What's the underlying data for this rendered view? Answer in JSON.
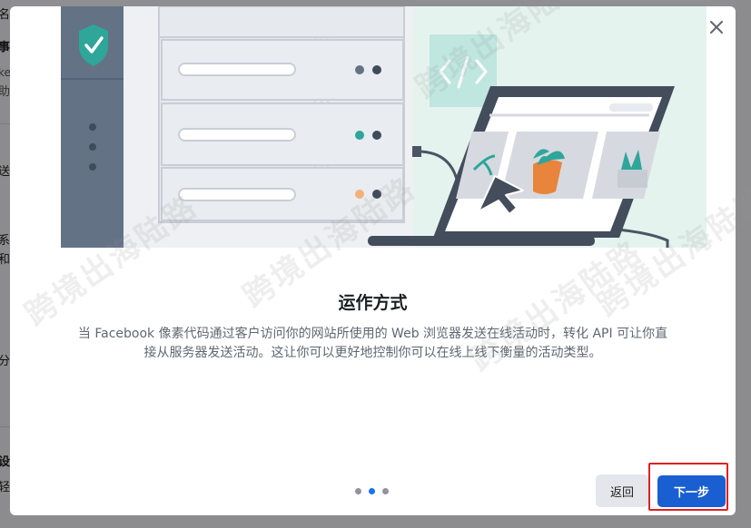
{
  "background": {
    "left_chars": [
      "名",
      "事",
      "ke",
      "助",
      "送",
      "系",
      "和",
      "分",
      "设",
      "轻"
    ]
  },
  "modal": {
    "close_icon": "close-icon",
    "title": "运作方式",
    "description": "当 Facebook 像素代码通过客户访问你的网站所使用的 Web 浏览器发送在线活动时，转化 API 可让你直接从服务器发送活动。这让你可以更好地控制你可以在线上线下衡量的活动类型。",
    "pagination": {
      "total": 3,
      "active_index": 1
    },
    "back_label": "返回",
    "next_label": "下一步"
  },
  "watermark": {
    "text": "跨境出海陆路"
  },
  "colors": {
    "accent": "#1a5fd1",
    "highlight": "#e02020",
    "hero_bg": "#e5f3ee",
    "server_dark": "#637285",
    "laptop_dark": "#434d5b"
  }
}
